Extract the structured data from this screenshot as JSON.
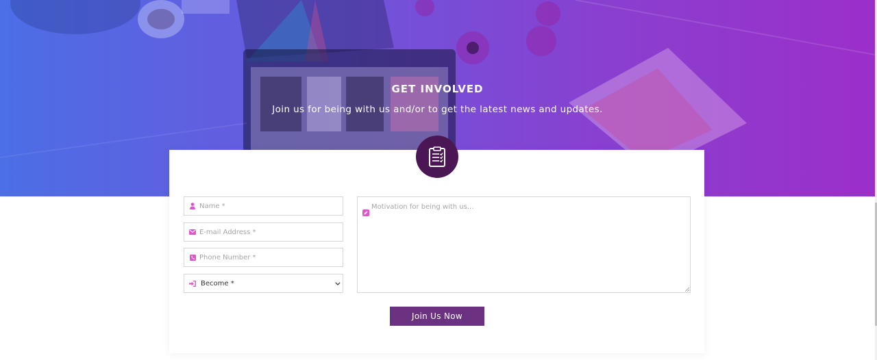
{
  "section": {
    "title": "GET INVOLVED",
    "subtitle": "Join us for being with us and/or to get the latest news and updates."
  },
  "form": {
    "name_placeholder": "Name *",
    "email_placeholder": "E-mail Address *",
    "phone_placeholder": "Phone Number *",
    "become_selected": "Become *",
    "motivation_placeholder": "Motivation for being with us...",
    "submit_label": "Join Us Now"
  },
  "icons": {
    "badge": "clipboard-list-icon",
    "name": "user-icon",
    "email": "envelope-icon",
    "phone": "phone-icon",
    "become": "sign-in-icon",
    "motivation": "edit-icon",
    "select_caret": "chevron-down-icon"
  },
  "colors": {
    "hero_gradient_start": "#4c6ee6",
    "hero_gradient_end": "#9b2fc9",
    "badge_bg": "#4a1654",
    "icon_accent": "#e056c9",
    "button_bg": "#6a3280"
  }
}
